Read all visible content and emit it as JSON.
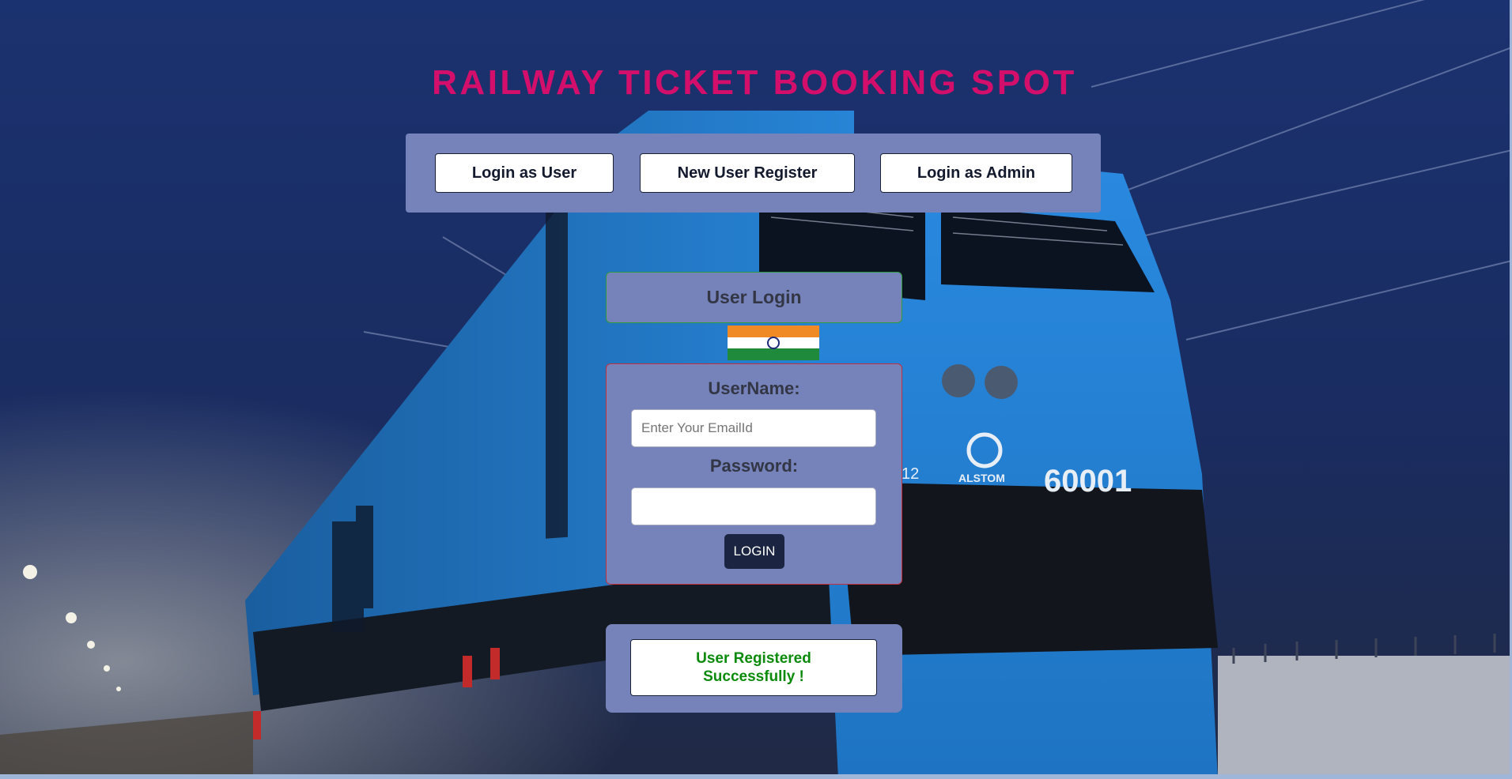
{
  "header": {
    "title": "RAILWAY TICKET BOOKING SPOT"
  },
  "nav": {
    "login_user": "Login as User",
    "new_user_register": "New User Register",
    "login_admin": "Login as Admin"
  },
  "login": {
    "heading": "User Login",
    "username_label": "UserName:",
    "username_placeholder": "Enter Your EmailId",
    "username_value": "",
    "password_label": "Password:",
    "password_value": "",
    "submit_label": "LOGIN"
  },
  "message": {
    "text": "User Registered Successfully !",
    "color": "#0b8a0b"
  },
  "background_scene": {
    "locomotive_number": "60001",
    "manufacturer_logo": "ALSTOM",
    "unit_code": "12"
  },
  "colors": {
    "title": "#d40f6b",
    "panel": "#7683ba",
    "button_dark": "#1b2440",
    "locomotive_blue": "#1f78c9"
  }
}
